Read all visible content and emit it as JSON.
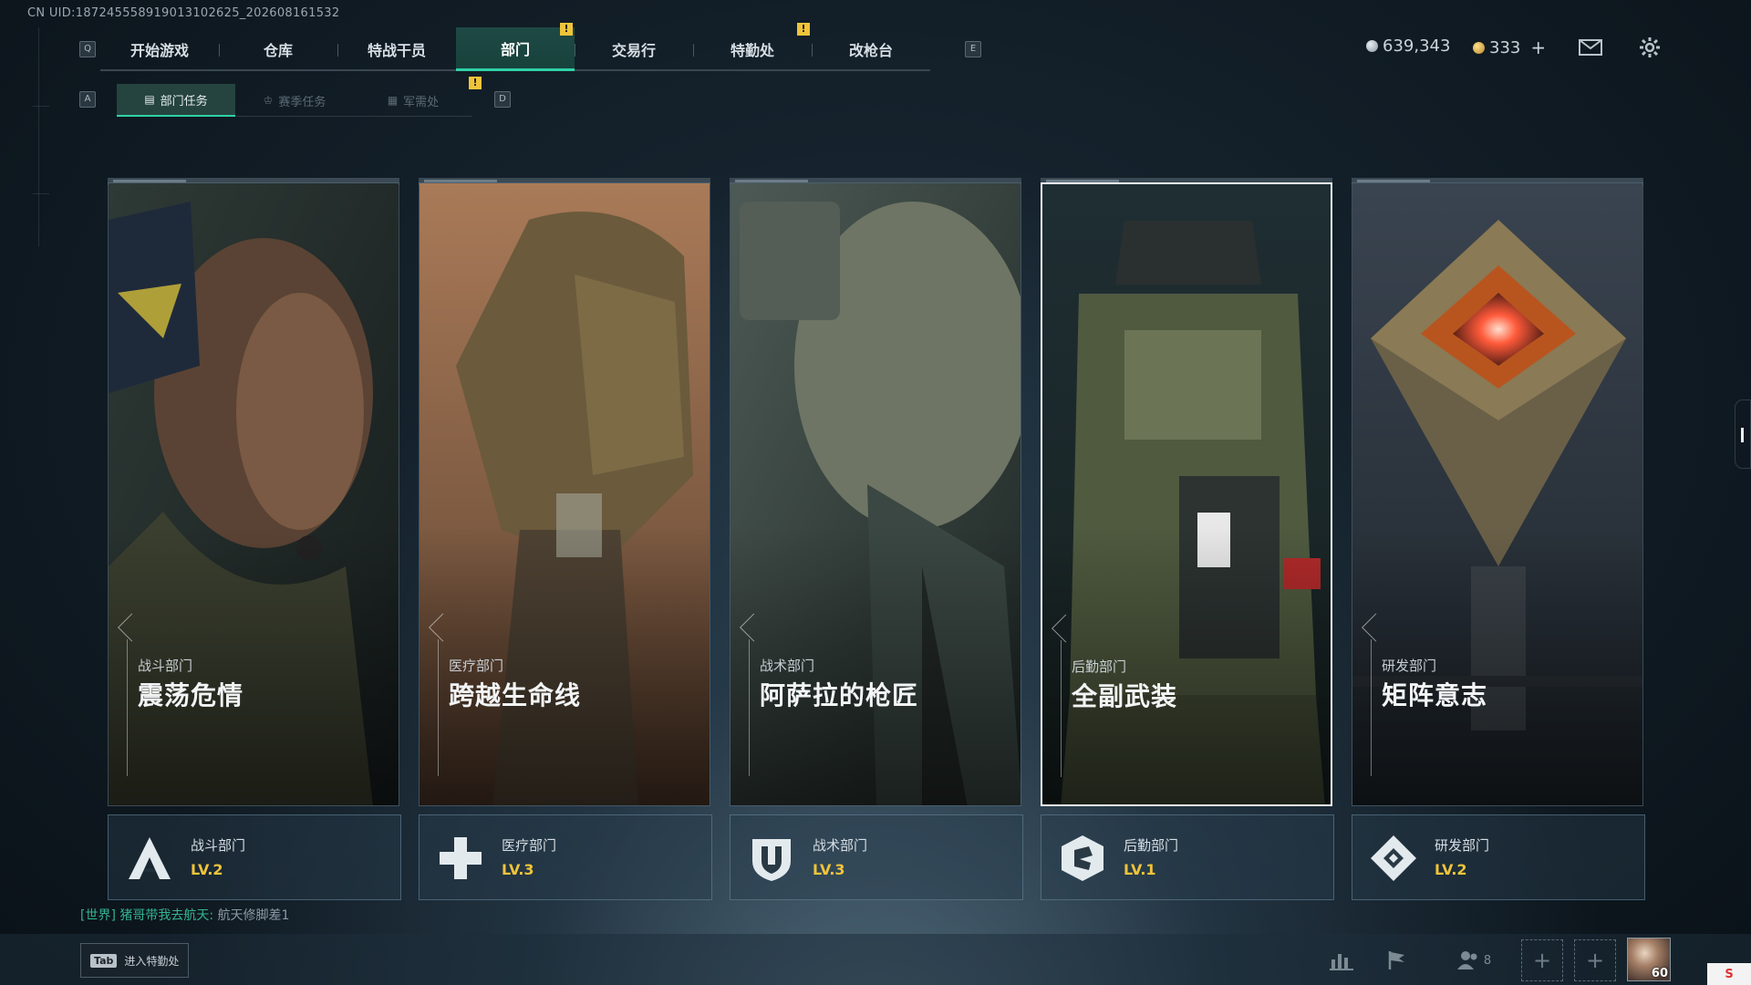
{
  "uid_text": "CN UID:18724555891901310262​5_202608161532",
  "nav": {
    "left_key": "Q",
    "right_key": "E",
    "tabs": [
      {
        "label": "开始游戏",
        "active": false,
        "notice": ""
      },
      {
        "label": "仓库",
        "active": false,
        "notice": ""
      },
      {
        "label": "特战干员",
        "active": false,
        "notice": ""
      },
      {
        "label": "部门",
        "active": true,
        "notice": "!"
      },
      {
        "label": "交易行",
        "active": false,
        "notice": ""
      },
      {
        "label": "特勤处",
        "active": false,
        "notice": "!"
      },
      {
        "label": "改枪台",
        "active": false,
        "notice": ""
      }
    ]
  },
  "subnav": {
    "left_key": "A",
    "right_key": "D",
    "tabs": [
      {
        "label": "部门任务",
        "icon": "document-icon",
        "active": true,
        "notice": ""
      },
      {
        "label": "赛季任务",
        "icon": "crown-icon",
        "active": false,
        "notice": ""
      },
      {
        "label": "军需处",
        "icon": "crate-icon",
        "active": false,
        "notice": "!"
      }
    ]
  },
  "currency": {
    "silver": "639,343",
    "gold": "333",
    "gold_add": "+"
  },
  "cards": [
    {
      "category": "战斗部门",
      "title": "震荡危情",
      "selected": false
    },
    {
      "category": "医疗部门",
      "title": "跨越生命线",
      "selected": false
    },
    {
      "category": "战术部门",
      "title": "阿萨拉的枪匠",
      "selected": false
    },
    {
      "category": "后勤部门",
      "title": "全副武装",
      "selected": true
    },
    {
      "category": "研发部门",
      "title": "矩阵意志",
      "selected": false
    }
  ],
  "departments": [
    {
      "name": "战斗部门",
      "level": "LV.2",
      "icon": "combat-a-icon"
    },
    {
      "name": "医疗部门",
      "level": "LV.3",
      "icon": "medical-cross-icon"
    },
    {
      "name": "战术部门",
      "level": "LV.3",
      "icon": "tactical-shield-icon"
    },
    {
      "name": "后勤部门",
      "level": "LV.1",
      "icon": "logistics-hex-icon"
    },
    {
      "name": "研发部门",
      "level": "LV.2",
      "icon": "research-diamond-icon"
    }
  ],
  "chat": {
    "channel": "[世界]",
    "sender": "猪哥带我去航天:",
    "message": "航天修脚差1"
  },
  "bottom": {
    "tab_key": "Tab",
    "tab_label": "进入特勤处",
    "friends_count": "8",
    "avatar_level": "60",
    "sys_badge": "S"
  },
  "colors": {
    "accent_teal": "#2fd2a6",
    "level_gold": "#f0c43a",
    "chat_green": "#35b38f"
  }
}
